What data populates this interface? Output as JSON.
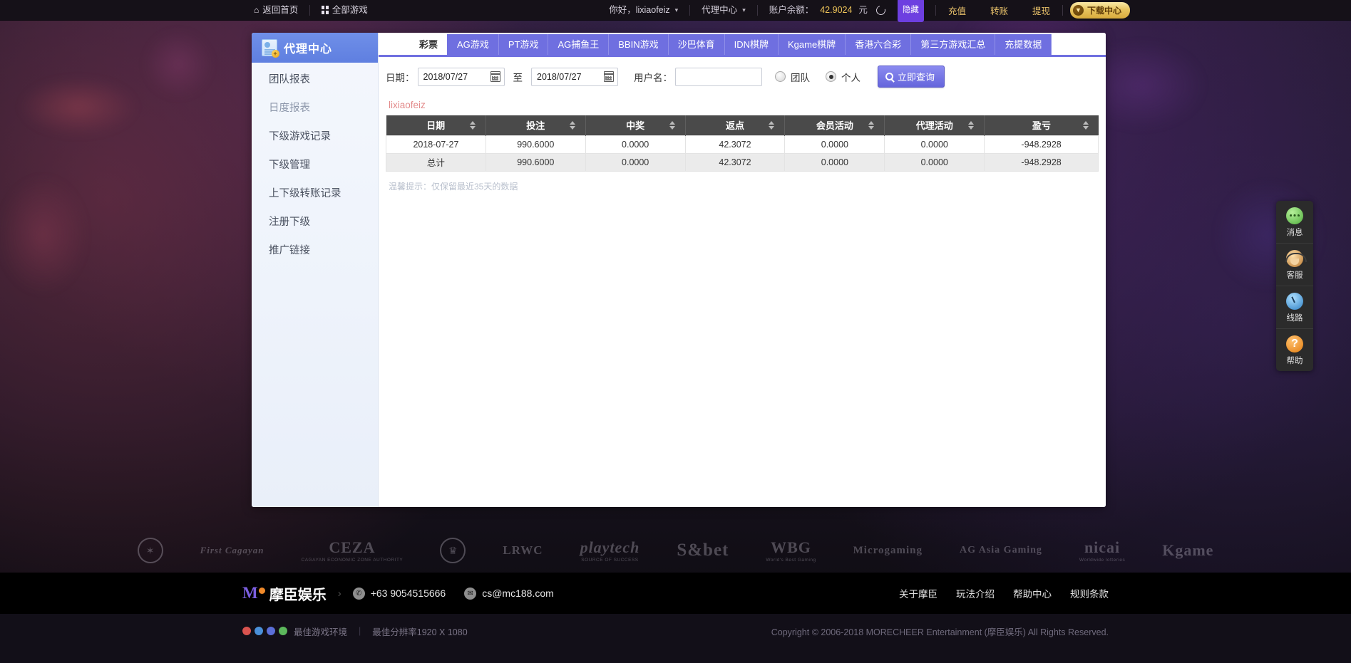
{
  "topbar": {
    "home": "返回首页",
    "all_games": "全部游戏",
    "greeting": "你好，lixiaofeiz",
    "agent_center": "代理中心",
    "balance_label": "账户余额：",
    "balance_value": "42.9024",
    "balance_unit": "元",
    "hide": "隐藏",
    "deposit": "充值",
    "transfer": "转账",
    "withdraw": "提现",
    "download": "下载中心"
  },
  "sidebar": {
    "title": "代理中心",
    "items": [
      {
        "label": "团队报表",
        "active": false
      },
      {
        "label": "日度报表",
        "active": true
      },
      {
        "label": "下级游戏记录",
        "active": false
      },
      {
        "label": "下级管理",
        "active": false
      },
      {
        "label": "上下级转账记录",
        "active": false
      },
      {
        "label": "注册下级",
        "active": false
      },
      {
        "label": "推广链接",
        "active": false
      }
    ]
  },
  "tabs": [
    {
      "label": "彩票",
      "active": true
    },
    {
      "label": "AG游戏",
      "active": false
    },
    {
      "label": "PT游戏",
      "active": false
    },
    {
      "label": "AG捕鱼王",
      "active": false
    },
    {
      "label": "BBIN游戏",
      "active": false
    },
    {
      "label": "沙巴体育",
      "active": false
    },
    {
      "label": "IDN棋牌",
      "active": false
    },
    {
      "label": "Kgame棋牌",
      "active": false
    },
    {
      "label": "香港六合彩",
      "active": false
    },
    {
      "label": "第三方游戏汇总",
      "active": false
    },
    {
      "label": "充提数据",
      "active": false
    }
  ],
  "filters": {
    "date_label": "日期：",
    "date_from": "2018/07/27",
    "date_to": "2018/07/27",
    "to_label": "至",
    "username_label": "用户名：",
    "username_value": "",
    "radio_team": "团队",
    "radio_personal": "个人",
    "selected": "个人",
    "query_button": "立即查询"
  },
  "report": {
    "account": "lixiaofeiz",
    "columns": [
      "日期",
      "投注",
      "中奖",
      "返点",
      "会员活动",
      "代理活动",
      "盈亏"
    ],
    "rows": [
      [
        "2018-07-27",
        "990.6000",
        "0.0000",
        "42.3072",
        "0.0000",
        "0.0000",
        "-948.2928"
      ]
    ],
    "total_row": [
      "总计",
      "990.6000",
      "0.0000",
      "42.3072",
      "0.0000",
      "0.0000",
      "-948.2928"
    ],
    "tip": "温馨提示：仅保留最近35天的数据"
  },
  "dock": [
    {
      "label": "消息",
      "icon": "message-icon"
    },
    {
      "label": "客服",
      "icon": "customer-service-icon"
    },
    {
      "label": "线路",
      "icon": "speedometer-icon"
    },
    {
      "label": "帮助",
      "icon": "help-icon"
    }
  ],
  "partners": [
    {
      "big": "",
      "sml": "",
      "type": "seal"
    },
    {
      "big": "First Cagayan",
      "sml": "",
      "type": "italic"
    },
    {
      "big": "CEZA",
      "sml": "CAGAYAN ECONOMIC ZONE AUTHORITY",
      "type": "text"
    },
    {
      "big": "",
      "sml": "",
      "type": "seal"
    },
    {
      "big": "LRWC",
      "sml": "",
      "type": "text"
    },
    {
      "big": "playtech",
      "sml": "SOURCE OF SUCCESS",
      "type": "italic"
    },
    {
      "big": "S&bet",
      "sml": "",
      "type": "text"
    },
    {
      "big": "WBG",
      "sml": "World's Best Gaming",
      "type": "text"
    },
    {
      "big": "Microgaming",
      "sml": "",
      "type": "text"
    },
    {
      "big": "AG Asia Gaming",
      "sml": "",
      "type": "text"
    },
    {
      "big": "nicai",
      "sml": "Worldwide lotteries",
      "type": "text"
    },
    {
      "big": "Kgame",
      "sml": "",
      "type": "text"
    }
  ],
  "footer": {
    "brand_mo": "M",
    "brand_cn": "摩臣娱乐",
    "phone": "+63 9054515666",
    "email": "cs@mc188.com",
    "links": [
      "关于摩臣",
      "玩法介绍",
      "帮助中心",
      "规则条款"
    ]
  },
  "copyline": {
    "best_env": "最佳游戏环境",
    "best_res": "最佳分辨率1920 X 1080",
    "copyright": "Copyright © 2006-2018 MORECHEER Entertainment (摩臣娱乐) All Rights Reserved."
  },
  "colors": {
    "accent_purple": "#6f6fe0",
    "gold": "#e8c16a",
    "balance": "#f0c659",
    "username_red": "#e38a8a"
  }
}
